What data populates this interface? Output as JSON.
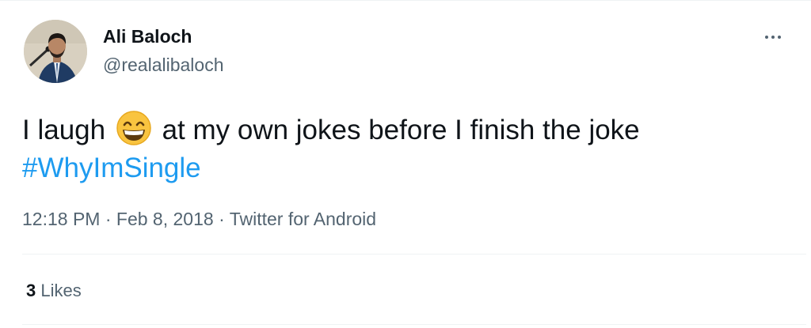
{
  "author": {
    "display_name": "Ali Baloch",
    "handle": "@realalibaloch"
  },
  "tweet": {
    "text_before_emoji": "I laugh",
    "emoji": "grinning-face-with-smiling-eyes",
    "text_after_emoji": "at my own jokes before I finish the joke",
    "hashtag": "#WhyImSingle"
  },
  "meta": {
    "time": "12:18 PM",
    "separator": "·",
    "date": "Feb 8, 2018",
    "source": "Twitter for Android"
  },
  "stats": {
    "likes_count": "3",
    "likes_label": "Likes"
  },
  "colors": {
    "accent": "#1d9bf0",
    "secondary_text": "#536471",
    "primary_text": "#0f1419",
    "divider": "#eff3f4"
  }
}
